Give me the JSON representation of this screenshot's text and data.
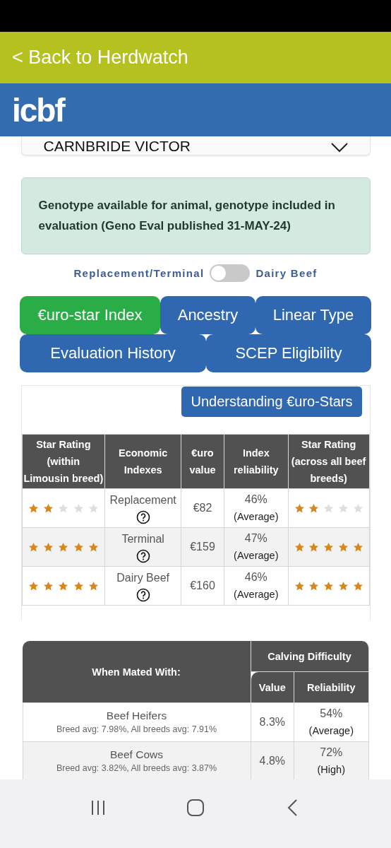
{
  "back_link": "< Back to Herdwatch",
  "logo": "icbf",
  "animal_select": {
    "value": "CARNBRIDE VICTOR"
  },
  "alert": "Genotype available for animal, genotype included in evaluation (Geno Eval published 31-MAY-24)",
  "index_toggle": {
    "left_label": "Replacement/Terminal",
    "right_label": "Dairy Beef",
    "on": false
  },
  "tabs": [
    {
      "label": "€uro-star Index",
      "selected": true
    },
    {
      "label": "Ancestry",
      "selected": false
    },
    {
      "label": "Linear Type",
      "selected": false
    },
    {
      "label": "Evaluation History",
      "selected": false
    },
    {
      "label": "SCEP Eligibility",
      "selected": false
    }
  ],
  "understanding_button": "Understanding €uro-Stars",
  "index_table": {
    "columns": [
      "Star Rating (within Limousin breed)",
      "Economic Indexes",
      "€uro value",
      "Index reliability",
      "Star Rating (across all beef breeds)"
    ],
    "rows": [
      {
        "breed_rating": {
          "stars": 2
        },
        "index": "Replacement",
        "value": "€82",
        "reliability": "46%",
        "reliability_level": "(Average)",
        "all_rating": {
          "stars": 2
        }
      },
      {
        "breed_rating": {
          "stars": 5
        },
        "index": "Terminal",
        "value": "€159",
        "reliability": "47%",
        "reliability_level": "(Average)",
        "all_rating": {
          "stars": 5
        }
      },
      {
        "breed_rating": {
          "stars": 5
        },
        "index": "Dairy Beef",
        "value": "€160",
        "reliability": "46%",
        "reliability_level": "(Average)",
        "all_rating": {
          "stars": 5
        }
      }
    ]
  },
  "calving_table": {
    "first_column": "When Mated With:",
    "group": "Calving Difficulty",
    "columns": [
      "Value",
      "Reliability"
    ],
    "rows": [
      {
        "name": "Beef Heifers",
        "note": "Breed avg: 7.98%, All breeds avg: 7.91%",
        "value": "8.3%",
        "reliability": "54%",
        "reliability_level": "(Average)"
      },
      {
        "name": "Beef Cows",
        "note": "Breed avg: 3.82%, All breeds avg: 3.87%",
        "value": "4.8%",
        "reliability": "72%",
        "reliability_level": "(High)"
      }
    ]
  }
}
